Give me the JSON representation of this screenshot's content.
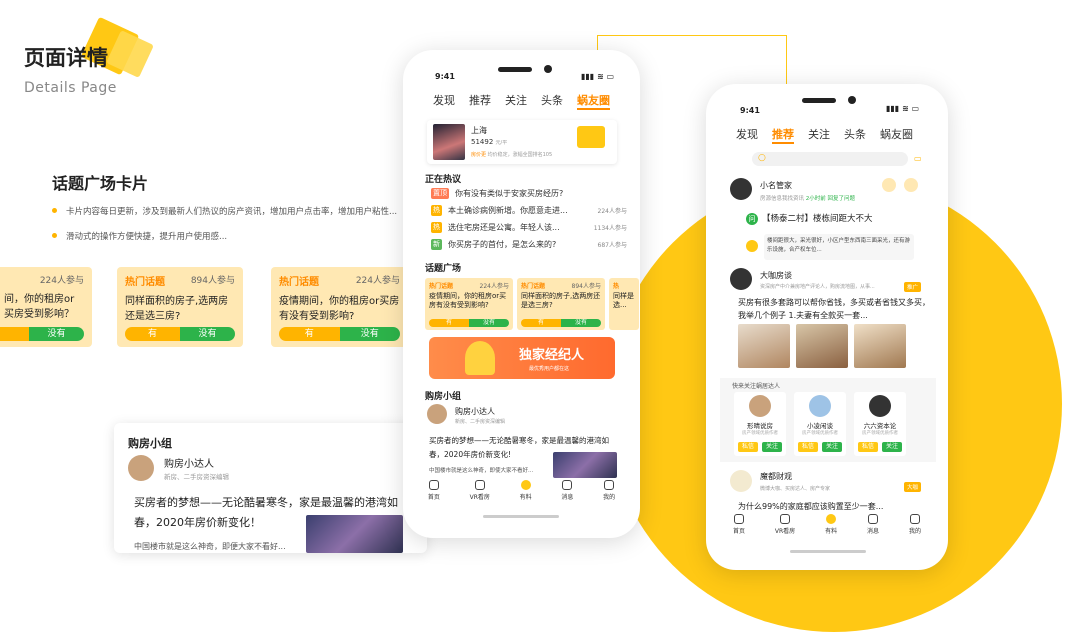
{
  "header": {
    "title": "页面详情",
    "subtitle": "Details Page"
  },
  "section": {
    "title": "话题广场卡片",
    "bullets": [
      "卡片内容每日更新，涉及到最新人们热议的房产资讯，增加用户点击率，增加用户粘性...",
      "滑动式的操作方便快捷，提升用户使用感..."
    ]
  },
  "topic_cards": [
    {
      "tag": "",
      "count": "224人参与",
      "q": "间，你的租房or买房受到影响？",
      "yes": "",
      "no": "没有"
    },
    {
      "tag": "热门话题",
      "count": "894人参与",
      "q": "同样面积的房子,选两房还是选三房?",
      "yes": "有",
      "no": "没有"
    },
    {
      "tag": "热门话题",
      "count": "224人参与",
      "q": "疫情期间，你的租房or买房有没有受到影响?",
      "yes": "有",
      "no": "没有"
    }
  ],
  "group_card": {
    "title": "购房小组",
    "user": "购房小达人",
    "meta": "新房、二手房资深编辑",
    "text": "买房者的梦想——无论酷暑寒冬，家是最温馨的港湾如春，2020年房价新变化！",
    "sub": "中国楼市就是这么神奇，即便大家不看好..."
  },
  "phone1": {
    "time": "9:41",
    "tabs": [
      "发现",
      "推荐",
      "关注",
      "头条",
      "蜗友圈"
    ],
    "city": {
      "name": "上海",
      "price": "51492",
      "unit": "元/平",
      "tag": "房价更",
      "info": "均价稳定，涨幅全国排名105"
    },
    "hot_title": "正在热议",
    "hot": [
      {
        "tag": "置顶",
        "text": "你有没有类似于安家买房经历?",
        "count": "",
        "color": "#ff7b54"
      },
      {
        "tag": "热",
        "text": "本土确诊病例新增。你愿意走进...",
        "count": "224人参与",
        "color": "#ffb400"
      },
      {
        "tag": "热",
        "text": "选住宅房还是公寓。年轻人该...",
        "count": "1134人参与",
        "color": "#ffb400"
      },
      {
        "tag": "新",
        "text": "你买房子的首付，是怎么来的?",
        "count": "687人参与",
        "color": "#5cb85c"
      }
    ],
    "square_title": "话题广场",
    "minis": [
      {
        "tag": "热门话题",
        "count": "224人参与",
        "q": "疫情期间，你的租房or买房有没有受到影响?",
        "yes": "有",
        "no": "没有"
      },
      {
        "tag": "热门话题",
        "count": "894人参与",
        "q": "同样面积的房子,选两房还是选三房?",
        "yes": "有",
        "no": "没有"
      },
      {
        "tag": "热",
        "count": "",
        "q": "同样是选...",
        "yes": "",
        "no": ""
      }
    ],
    "banner": {
      "title": "独家经纪人",
      "sub": "最优秀用户都在这"
    },
    "group_title": "购房小组",
    "group_user": "购房小达人",
    "group_meta": "新房、二手房资深编辑",
    "group_text": "买房者的梦想——无论酷暑寒冬，家是最温馨的港湾如春，2020年房价新变化!",
    "group_sub": "中国楼市就是这么神奇，即使大家不看好...",
    "nav": [
      "首页",
      "VR看房",
      "有料",
      "消息",
      "我的"
    ]
  },
  "phone2": {
    "time": "9:41",
    "tabs": [
      "发现",
      "推荐",
      "关注",
      "头条",
      "蜗友圈"
    ],
    "post1": {
      "name": "小名管家",
      "meta": "房源信息我找资讯",
      "time": "2小时前",
      "reply": "回复了问题",
      "q": "【杨泰二村】楼栋间距大不大",
      "a": "楼间距很大，采光很好，小区户型东西南三面采光，还有游乐设施，合产权车位..."
    },
    "post2": {
      "name": "大咖房谈",
      "meta": "资深房产中介兼房地产评论人，购房流地图，从事...",
      "badge": "推广",
      "text": "买房有很多套路可以帮你省钱，多买或者省钱又多买，我举几个例子 1.夫妻有全款买一套..."
    },
    "recommend_title": "快来关注蜗居达人",
    "users": [
      {
        "name": "形晴说房",
        "meta": "房产领域优质作者",
        "a": "私信",
        "b": "关注"
      },
      {
        "name": "小凌闲谈",
        "meta": "房产领域优质作者",
        "a": "私信",
        "b": "关注"
      },
      {
        "name": "六六资本论",
        "meta": "房产领域优质作者",
        "a": "私信",
        "b": "关注"
      }
    ],
    "post3": {
      "name": "魔都财观",
      "meta": "微博大咖、买房达人、房产专家",
      "badge": "大咖",
      "text": "为什么99%的家庭都应该购置至少一套..."
    },
    "nav": [
      "首页",
      "VR看房",
      "有料",
      "消息",
      "我的"
    ]
  }
}
